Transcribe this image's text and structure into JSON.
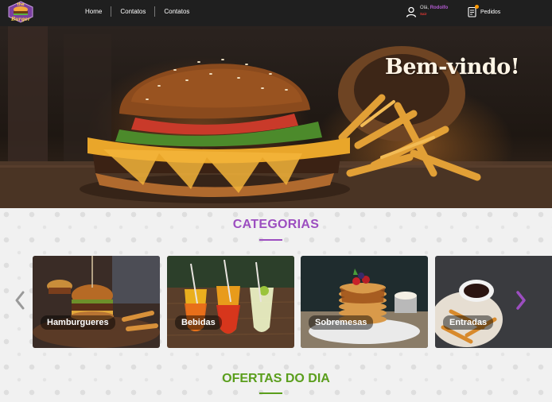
{
  "brand": {
    "logo_text_top": "the",
    "logo_text_bottom": "Burger"
  },
  "nav": {
    "links": [
      {
        "label": "Home"
      },
      {
        "label": "Contatos"
      },
      {
        "label": "Contatos"
      }
    ]
  },
  "user": {
    "greeting": "Olá,",
    "name": "Rodolfo",
    "sub": "Sair"
  },
  "orders": {
    "label": "Pedidos",
    "badge_color": "#ff9800"
  },
  "hero": {
    "title": "Bem-vindo!"
  },
  "categories": {
    "title": "CATEGORIAS",
    "accent": "#9c4ec0",
    "items": [
      {
        "label": "Hamburgueres"
      },
      {
        "label": "Bebidas"
      },
      {
        "label": "Sobremesas"
      },
      {
        "label": "Entradas"
      }
    ]
  },
  "offers": {
    "title": "OFERTAS DO DIA",
    "accent": "#5a9e1c"
  }
}
